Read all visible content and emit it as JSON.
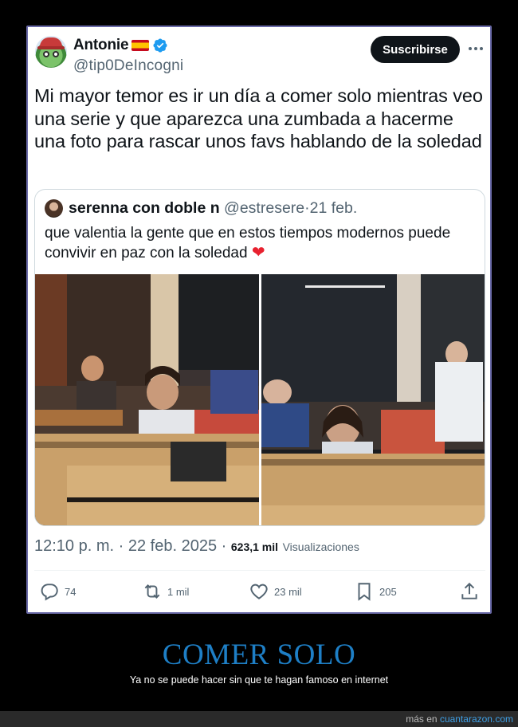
{
  "post": {
    "display_name": "Antonie",
    "handle": "@tip0DeIncogni",
    "subscribe_label": "Suscribirse",
    "text": "Mi mayor temor es ir un día a comer solo mientras veo una serie y que aparezca una zumbada a hacerme una foto para rascar unos favs hablando de la soledad",
    "time": "12:10 p. m.",
    "date_sep": "·",
    "date": "22 feb. 2025",
    "views_count": "623,1 mil",
    "views_label": "Visualizaciones"
  },
  "quote": {
    "name": "serenna con doble n",
    "handle": "@estresere",
    "sep": "·",
    "date": "21 feb.",
    "text": "que valentia la gente que en estos tiempos modernos puede convivir en paz con la soledad",
    "emoji": "❤️"
  },
  "actions": {
    "replies": "74",
    "reposts": "1 mil",
    "likes": "23 mil",
    "bookmarks": "205"
  },
  "banner": {
    "title": "COMER SOLO",
    "subtitle": "Ya no se puede hacer sin que te hagan famoso en internet"
  },
  "footer": {
    "prefix": "más en",
    "site": "cuantarazon.com"
  },
  "colors": {
    "page_bg": "#000000",
    "card_border": "#6a6aa8",
    "banner_title": "#1e7fc6",
    "link": "#3fa0e6",
    "verified": "#1d9bf0",
    "heart": "#e8212f"
  },
  "icons": {
    "verified": "verified-badge-icon",
    "flag": "spain-flag-icon",
    "more": "more-dots-icon",
    "reply": "reply-icon",
    "repost": "repost-icon",
    "like": "like-icon",
    "bookmark": "bookmark-icon",
    "share": "share-icon"
  }
}
